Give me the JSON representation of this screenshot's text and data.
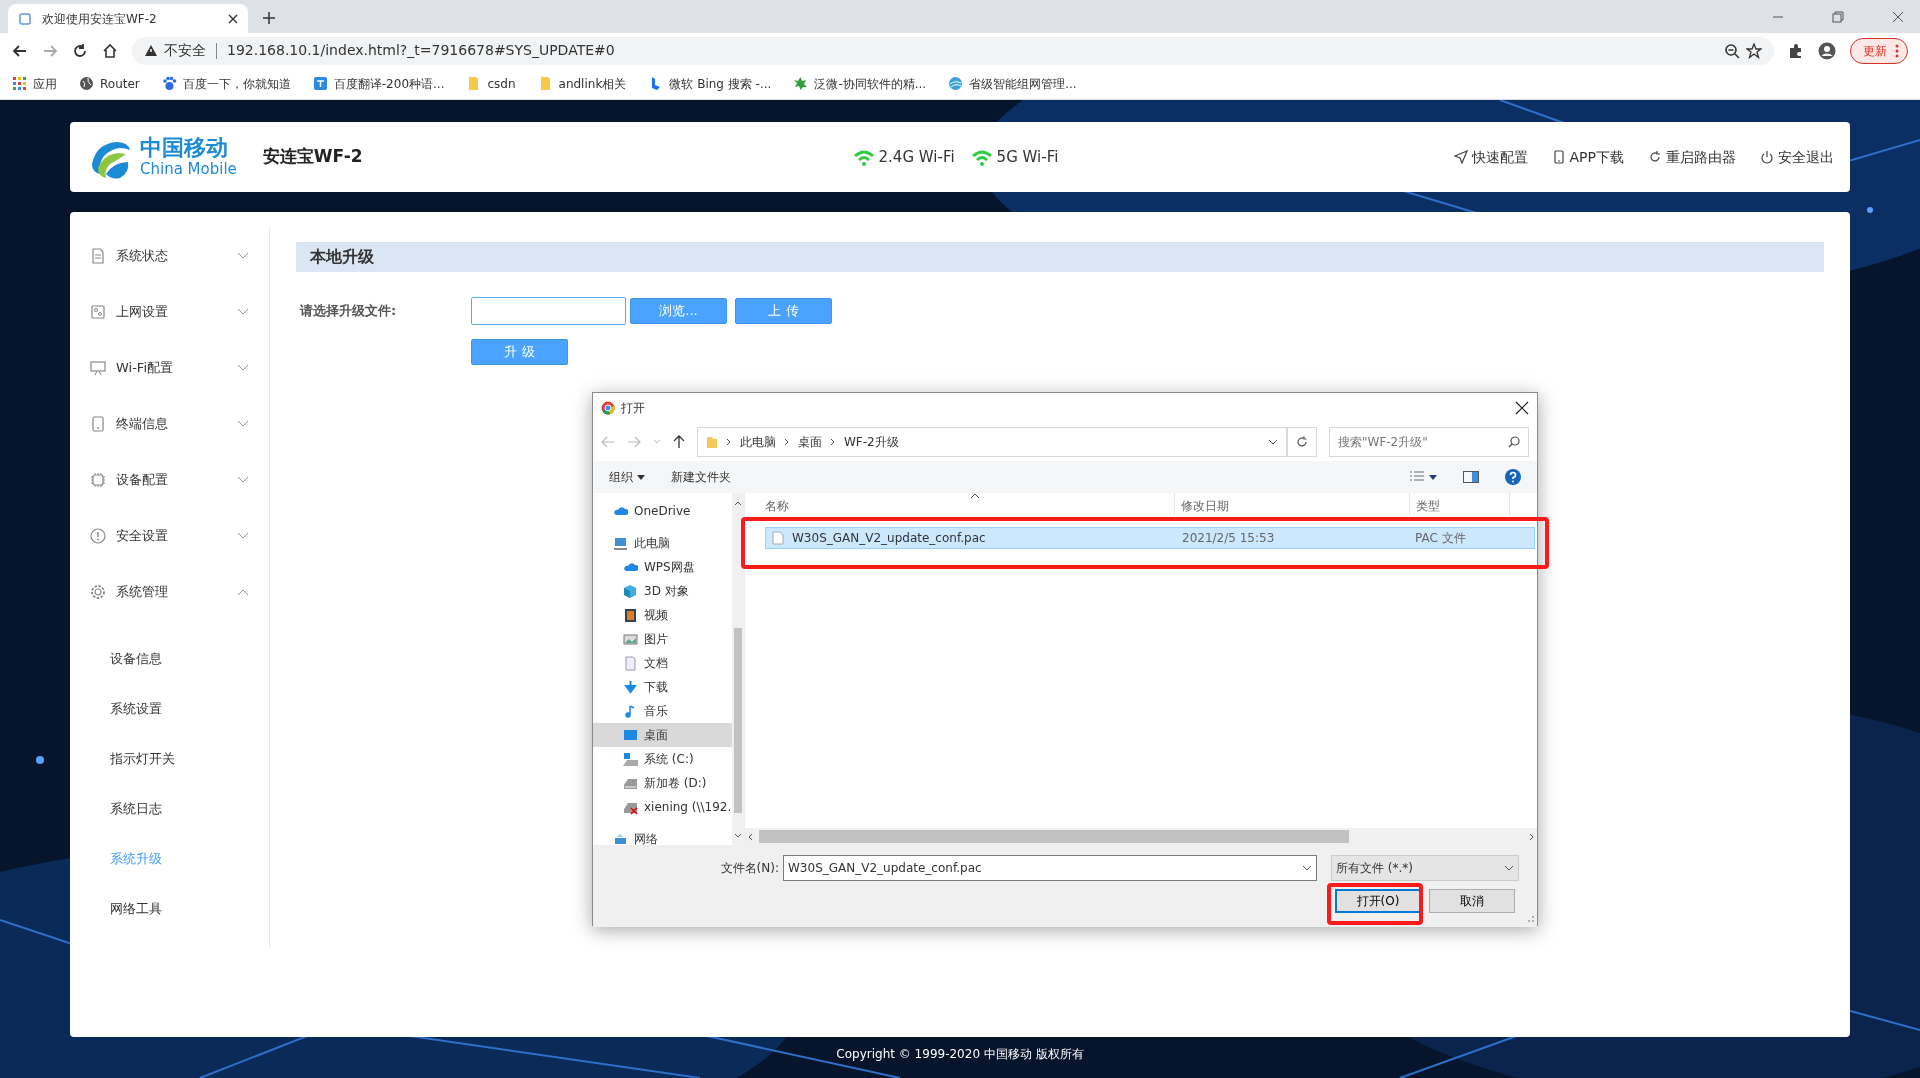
{
  "browser": {
    "tab_title": "欢迎使用安连宝WF-2",
    "security": "不安全",
    "url": "192.168.10.1/index.html?_t=7916678#SYS_UPDATE#0",
    "update_button": "更新",
    "bookmarks": [
      "应用",
      "Router",
      "百度一下，你就知道",
      "百度翻译-200种语...",
      "csdn",
      "andlink相关",
      "微软 Bing 搜索 -...",
      "泛微-协同软件的精...",
      "省级智能组网管理..."
    ]
  },
  "header": {
    "logo_cn": "中国移动",
    "logo_en": "China Mobile",
    "product": "安连宝WF-2",
    "wifi": [
      "2.4G Wi-Fi",
      "5G Wi-Fi"
    ],
    "actions": [
      "快速配置",
      "APP下载",
      "重启路由器",
      "安全退出"
    ]
  },
  "sidebar": {
    "items": [
      {
        "label": "系统状态",
        "expanded": false
      },
      {
        "label": "上网设置",
        "expanded": false
      },
      {
        "label": "Wi-Fi配置",
        "expanded": false
      },
      {
        "label": "终端信息",
        "expanded": false
      },
      {
        "label": "设备配置",
        "expanded": false
      },
      {
        "label": "安全设置",
        "expanded": false
      },
      {
        "label": "系统管理",
        "expanded": true,
        "children": [
          {
            "label": "设备信息",
            "selected": false
          },
          {
            "label": "系统设置",
            "selected": false
          },
          {
            "label": "指示灯开关",
            "selected": false
          },
          {
            "label": "系统日志",
            "selected": false
          },
          {
            "label": "系统升级",
            "selected": true
          },
          {
            "label": "网络工具",
            "selected": false
          }
        ]
      }
    ]
  },
  "section_title": "本地升级",
  "form": {
    "label": "请选择升级文件:",
    "browse": "浏览...",
    "upload": "上 传",
    "upgrade": "升 级"
  },
  "dialog": {
    "title": "打开",
    "path": [
      "此电脑",
      "桌面",
      "WF-2升级"
    ],
    "search_placeholder": "搜索\"WF-2升级\"",
    "toolbar": [
      "组织",
      "新建文件夹"
    ],
    "nav": [
      {
        "label": "OneDrive",
        "selected": false
      },
      {
        "label": "此电脑",
        "selected": false,
        "children": [
          {
            "label": "WPS网盘",
            "selected": false
          },
          {
            "label": "3D 对象",
            "selected": false
          },
          {
            "label": "视频",
            "selected": false
          },
          {
            "label": "图片",
            "selected": false
          },
          {
            "label": "文档",
            "selected": false
          },
          {
            "label": "下载",
            "selected": false
          },
          {
            "label": "音乐",
            "selected": false
          },
          {
            "label": "桌面",
            "selected": true
          },
          {
            "label": "系统 (C:)",
            "selected": false
          },
          {
            "label": "新加卷 (D:)",
            "selected": false
          },
          {
            "label": "xiening (\\\\192.",
            "selected": false
          }
        ]
      },
      {
        "label": "网络",
        "selected": false
      }
    ],
    "columns": [
      "名称",
      "修改日期",
      "类型"
    ],
    "files": [
      {
        "name": "W30S_GAN_V2_update_conf.pac",
        "date": "2021/2/5 15:53",
        "type": "PAC 文件",
        "selected": true
      }
    ],
    "filename_label": "文件名(N):",
    "filename": "W30S_GAN_V2_update_conf.pac",
    "filetype": "所有文件 (*.*)",
    "buttons": [
      "打开(O)",
      "取消"
    ]
  },
  "footer": "Copyright © 1999-2020 中国移动 版权所有"
}
